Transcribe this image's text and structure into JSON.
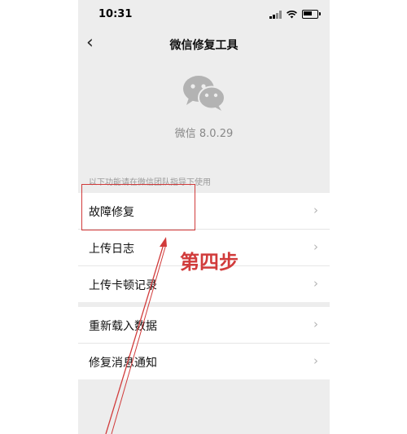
{
  "status_bar": {
    "time": "10:31"
  },
  "nav": {
    "back": "‹",
    "title": "微信修复工具"
  },
  "app": {
    "version": "微信 8.0.29"
  },
  "hint": "以下功能请在微信团队指导下使用",
  "group1": [
    {
      "label": "故障修复"
    },
    {
      "label": "上传日志"
    },
    {
      "label": "上传卡顿记录"
    }
  ],
  "group2": [
    {
      "label": "重新载入数据"
    },
    {
      "label": "修复消息通知"
    }
  ],
  "chevron": "›",
  "annotation": {
    "step": "第四步",
    "color": "#d13b3b"
  },
  "icons": [
    "wechat-logo-icon",
    "signal-icon",
    "wifi-icon",
    "battery-icon",
    "back-icon",
    "chevron-right-icon"
  ]
}
